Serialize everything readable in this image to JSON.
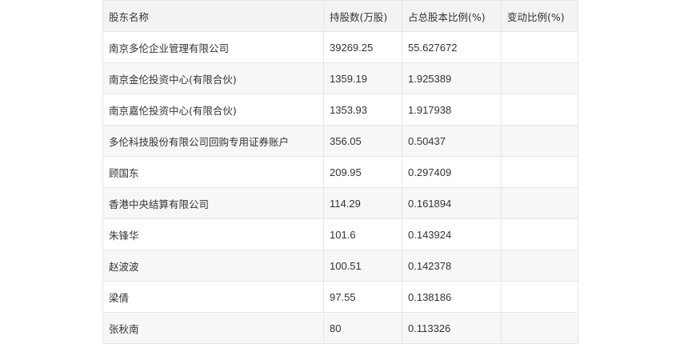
{
  "table": {
    "headers": [
      "股东名称",
      "持股数(万股)",
      "占总股本比例(%)",
      "变动比例(%)"
    ],
    "rows": [
      {
        "name": "南京多伦企业管理有限公司",
        "shares": "39269.25",
        "ratio": "55.627672",
        "change": ""
      },
      {
        "name": "南京金伦投资中心(有限合伙)",
        "shares": "1359.19",
        "ratio": "1.925389",
        "change": ""
      },
      {
        "name": "南京嘉伦投资中心(有限合伙)",
        "shares": "1353.93",
        "ratio": "1.917938",
        "change": ""
      },
      {
        "name": "多伦科技股份有限公司回购专用证券账户",
        "shares": "356.05",
        "ratio": "0.50437",
        "change": ""
      },
      {
        "name": "顾国东",
        "shares": "209.95",
        "ratio": "0.297409",
        "change": ""
      },
      {
        "name": "香港中央结算有限公司",
        "shares": "114.29",
        "ratio": "0.161894",
        "change": ""
      },
      {
        "name": "朱锋华",
        "shares": "101.6",
        "ratio": "0.143924",
        "change": ""
      },
      {
        "name": "赵波波",
        "shares": "100.51",
        "ratio": "0.142378",
        "change": ""
      },
      {
        "name": "梁倩",
        "shares": "97.55",
        "ratio": "0.138186",
        "change": ""
      },
      {
        "name": "张秋南",
        "shares": "80",
        "ratio": "0.113326",
        "change": ""
      }
    ]
  }
}
